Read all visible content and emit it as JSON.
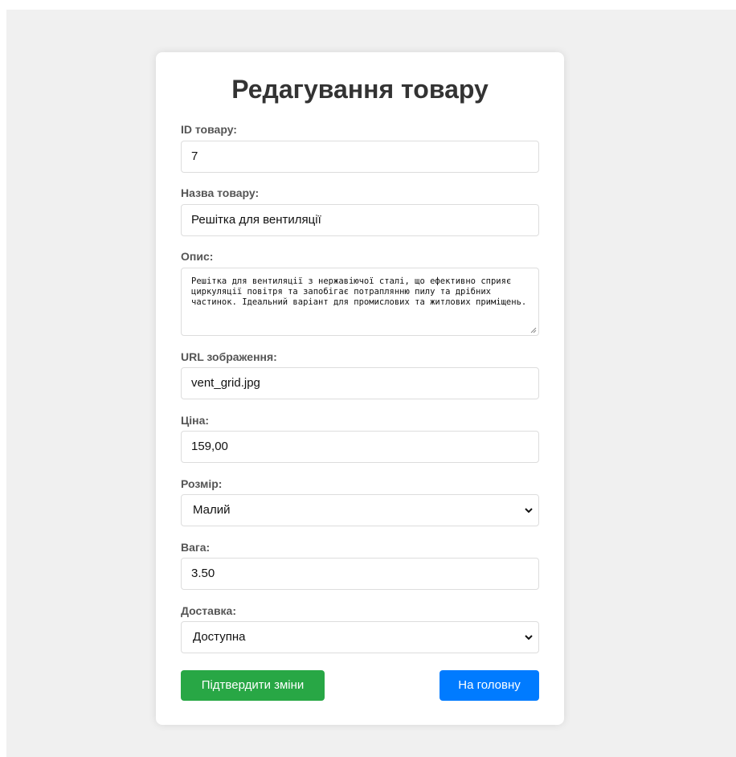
{
  "page": {
    "title": "Редагування товару"
  },
  "form": {
    "id": {
      "label": "ID товару:",
      "value": "7"
    },
    "name": {
      "label": "Назва товару:",
      "value": "Решітка для вентиляції"
    },
    "description": {
      "label": "Опис:",
      "value": "Решітка для вентиляції з нержавіючої сталі, що ефективно сприяє циркуляції повітря та запобігає потраплянню пилу та дрібних частинок. Ідеальний варіант для промислових та житлових приміщень."
    },
    "image_url": {
      "label": "URL зображення:",
      "value": "vent_grid.jpg"
    },
    "price": {
      "label": "Ціна:",
      "value": "159,00"
    },
    "size": {
      "label": "Розмір:",
      "selected": "Малий",
      "icon": "chevron-down-icon"
    },
    "weight": {
      "label": "Вага:",
      "value": "3.50"
    },
    "delivery": {
      "label": "Доставка:",
      "selected": "Доступна",
      "icon": "chevron-down-icon"
    }
  },
  "buttons": {
    "confirm": {
      "label": "Підтвердити зміни",
      "color": "#28a745"
    },
    "home": {
      "label": "На головну",
      "color": "#007bff"
    }
  }
}
